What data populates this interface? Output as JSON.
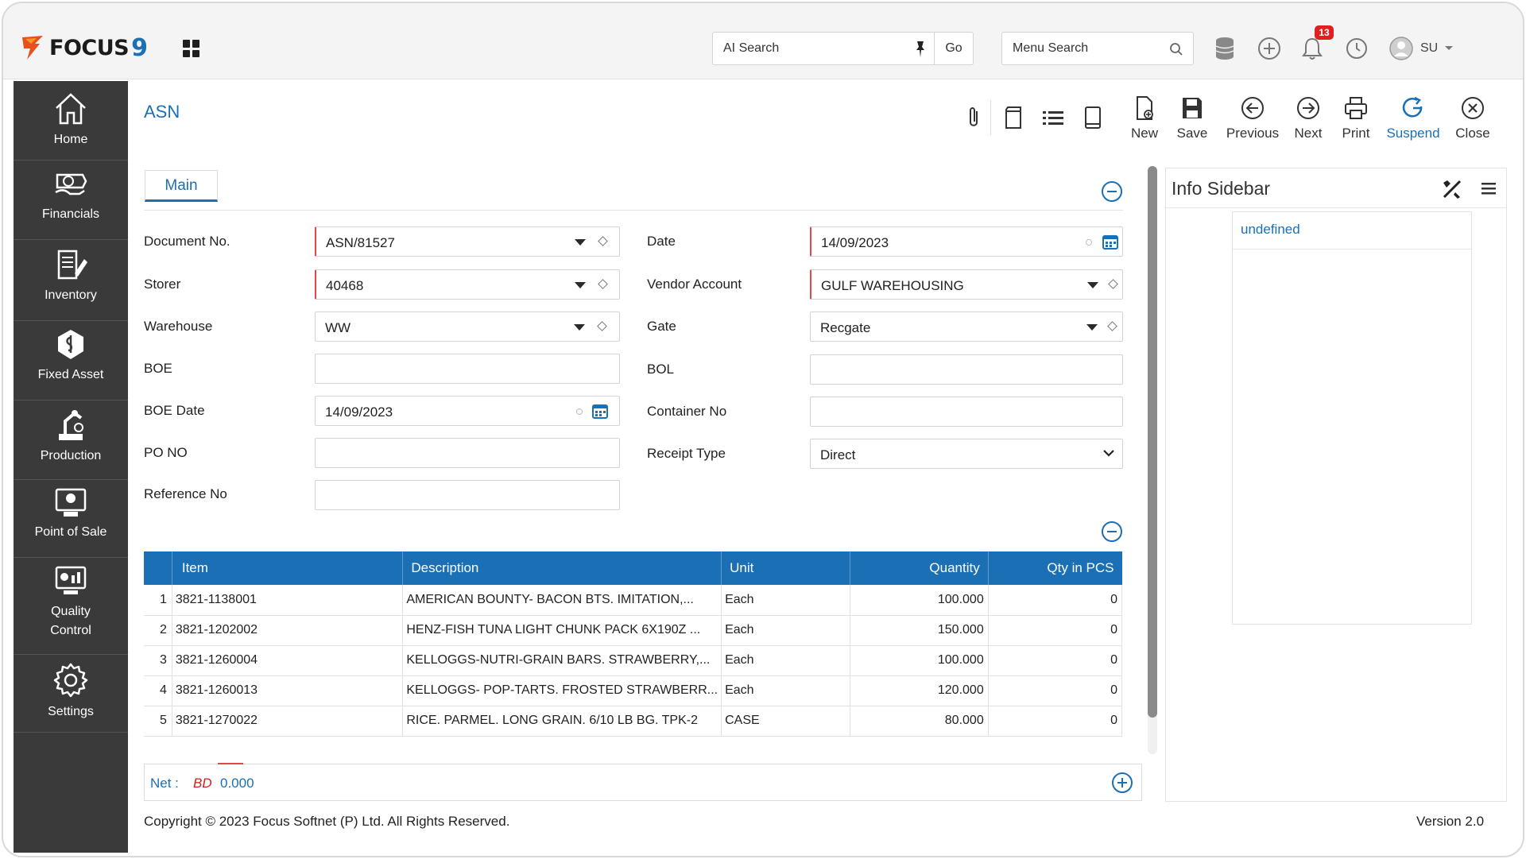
{
  "topbar": {
    "logo_text": "FOCUS",
    "logo_number": "9",
    "ai_search_label": "AI Search",
    "go_label": "Go",
    "menu_search_label": "Menu Search",
    "notification_count": "13",
    "user_initials": "SU"
  },
  "sidebar": {
    "items": [
      {
        "label": "Home",
        "icon": "home-icon"
      },
      {
        "label": "Financials",
        "icon": "financials-icon"
      },
      {
        "label": "Inventory",
        "icon": "inventory-icon"
      },
      {
        "label": "Fixed Asset",
        "icon": "fixed-asset-icon"
      },
      {
        "label": "Production",
        "icon": "production-icon"
      },
      {
        "label": "Point of Sale",
        "icon": "point-of-sale-icon"
      },
      {
        "label": "Quality",
        "label2": "Control",
        "icon": "quality-control-icon"
      },
      {
        "label": "Settings",
        "icon": "settings-icon"
      }
    ]
  },
  "page": {
    "title": "ASN"
  },
  "toolbar": {
    "new_label": "New",
    "save_label": "Save",
    "previous_label": "Previous",
    "next_label": "Next",
    "print_label": "Print",
    "suspend_label": "Suspend",
    "close_label": "Close"
  },
  "form": {
    "tab_label": "Main",
    "document_no": {
      "label": "Document No.",
      "value": "ASN/81527"
    },
    "date": {
      "label": "Date",
      "value": "14/09/2023"
    },
    "storer": {
      "label": "Storer",
      "value": "40468"
    },
    "vendor_account": {
      "label": "Vendor Account",
      "value": "GULF WAREHOUSING"
    },
    "warehouse": {
      "label": "Warehouse",
      "value": "WW"
    },
    "gate": {
      "label": "Gate",
      "value": "Recgate"
    },
    "boe": {
      "label": "BOE",
      "value": ""
    },
    "bol": {
      "label": "BOL",
      "value": ""
    },
    "boe_date": {
      "label": "BOE Date",
      "value": "14/09/2023"
    },
    "container_no": {
      "label": "Container No",
      "value": ""
    },
    "po_no": {
      "label": "PO NO",
      "value": ""
    },
    "receipt_type": {
      "label": "Receipt Type",
      "value": "Direct"
    },
    "reference_no": {
      "label": "Reference No",
      "value": ""
    }
  },
  "table": {
    "headers": [
      "Item",
      "Description",
      "Unit",
      "Quantity",
      "Qty in PCS"
    ],
    "rows": [
      {
        "n": "1",
        "item": "3821-1138001",
        "desc": "AMERICAN BOUNTY- BACON BTS. IMITATION,...",
        "unit": "Each",
        "qty": "100.000",
        "pcs": "0"
      },
      {
        "n": "2",
        "item": "3821-1202002",
        "desc": "HENZ-FISH TUNA LIGHT CHUNK PACK 6X190Z ...",
        "unit": "Each",
        "qty": "150.000",
        "pcs": "0"
      },
      {
        "n": "3",
        "item": "3821-1260004",
        "desc": "KELLOGGS-NUTRI-GRAIN BARS. STRAWBERRY,...",
        "unit": "Each",
        "qty": "100.000",
        "pcs": "0"
      },
      {
        "n": "4",
        "item": "3821-1260013",
        "desc": "KELLOGGS- POP-TARTS. FROSTED STRAWBERR...",
        "unit": "Each",
        "qty": "120.000",
        "pcs": "0"
      },
      {
        "n": "5",
        "item": "3821-1270022",
        "desc": "RICE. PARMEL. LONG GRAIN. 6/10 LB BG. TPK-2",
        "unit": "CASE",
        "qty": "80.000",
        "pcs": "0"
      }
    ]
  },
  "net": {
    "label": "Net :",
    "currency": "BD",
    "amount": "0.000"
  },
  "footer": {
    "copyright": "Copyright © 2023 Focus Softnet (P) Ltd. All Rights Reserved.",
    "version": "Version 2.0"
  },
  "info_sidebar": {
    "title": "Info Sidebar",
    "link": "undefined"
  },
  "colors": {
    "accent": "#1b6fb5",
    "sidebar_bg": "#3a3a3a",
    "required": "#e04848",
    "badge": "#e02020"
  }
}
